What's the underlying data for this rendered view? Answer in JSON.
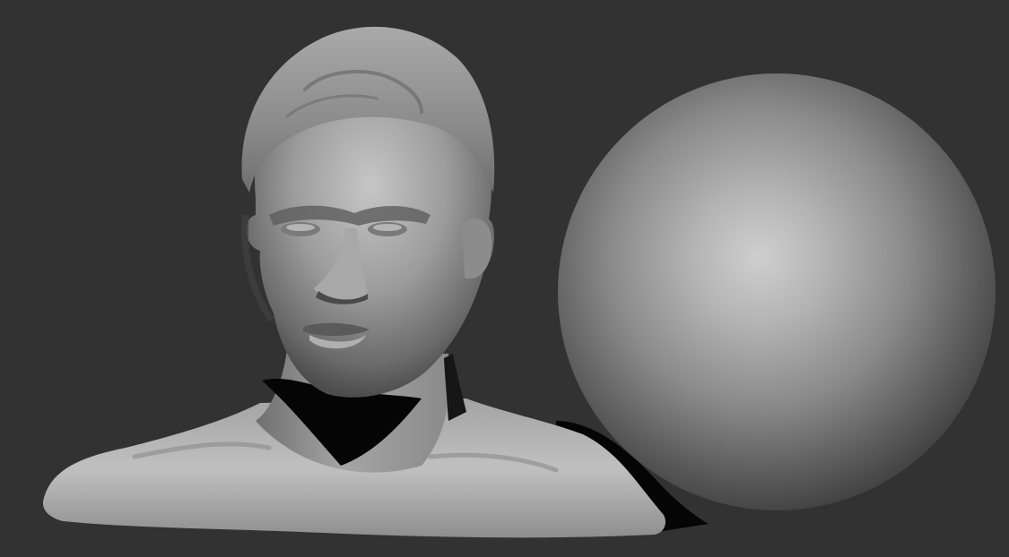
{
  "scene": {
    "kind": "3d-sculpt-render",
    "background_color": "#323232",
    "material_color": "#9a9a9a",
    "objects": [
      {
        "name": "bust-sculpt",
        "type": "human male head and shoulders"
      },
      {
        "name": "sphere-primitive",
        "type": "sphere"
      }
    ]
  }
}
